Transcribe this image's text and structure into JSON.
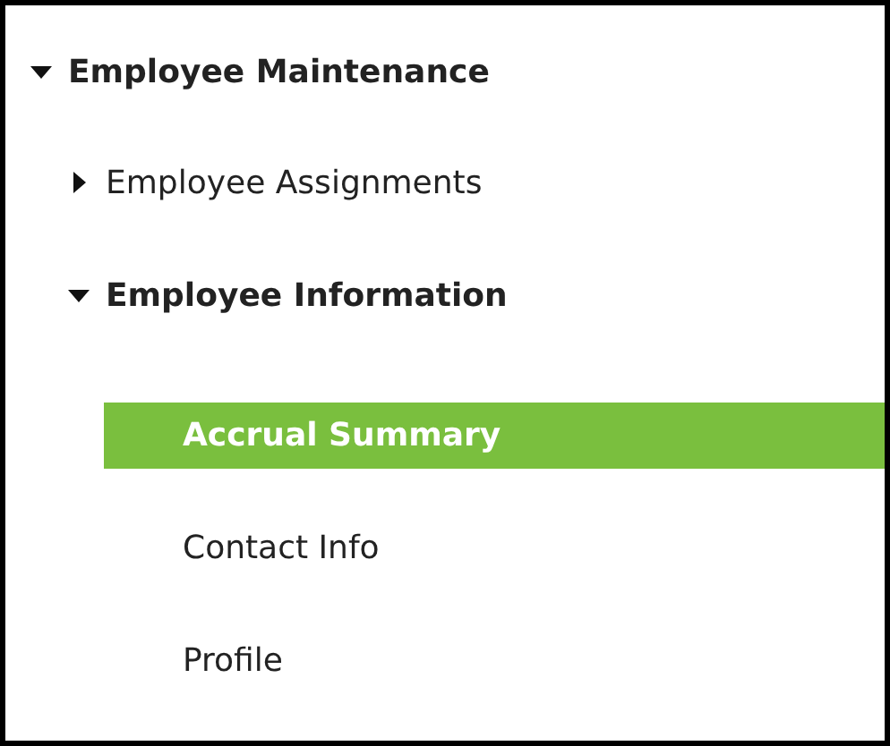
{
  "tree": [
    {
      "label": "Employee Maintenance",
      "expanded": true,
      "children": [
        {
          "label": "Employee Assignments",
          "expanded": false
        },
        {
          "label": "Employee Information",
          "expanded": true,
          "children": [
            {
              "label": "Accrual Summary",
              "selected": true
            },
            {
              "label": "Contact Info",
              "selected": false
            },
            {
              "label": "Profile",
              "selected": false
            }
          ]
        }
      ]
    }
  ]
}
